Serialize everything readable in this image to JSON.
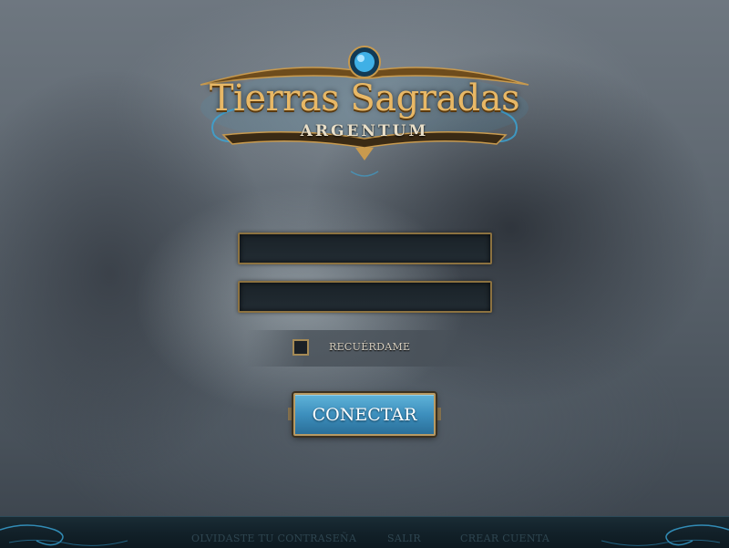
{
  "logo": {
    "title": "Tierras Sagradas",
    "subtitle": "ARGENTUM"
  },
  "login": {
    "username_value": "",
    "password_value": "",
    "remember_label": "RECUÉRDAME",
    "remember_checked": false,
    "connect_label": "CONECTAR"
  },
  "footer": {
    "links": [
      "OLVIDASTE TU CONTRASEÑA",
      "SALIR",
      "CREAR CUENTA"
    ]
  },
  "colors": {
    "gold": "#e8b866",
    "button_blue": "#3d8fbd",
    "field_border": "#8c7240",
    "footer_bg": "#122129"
  }
}
